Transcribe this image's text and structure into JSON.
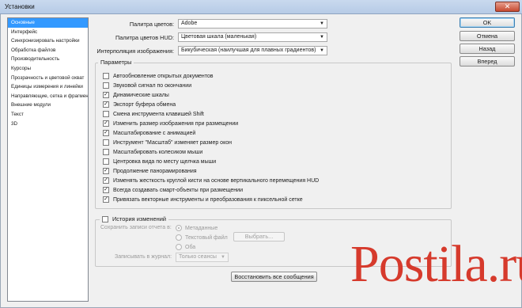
{
  "window": {
    "title": "Установки",
    "close_glyph": "✕"
  },
  "sidebar": {
    "items": [
      {
        "label": "Основные",
        "selected": true
      },
      {
        "label": "Интерфейс",
        "selected": false
      },
      {
        "label": "Синхронизировать настройки",
        "selected": false
      },
      {
        "label": "Обработка файлов",
        "selected": false
      },
      {
        "label": "Производительность",
        "selected": false
      },
      {
        "label": "Курсоры",
        "selected": false
      },
      {
        "label": "Прозрачность и цветовой охват",
        "selected": false
      },
      {
        "label": "Единицы измерения и линейки",
        "selected": false
      },
      {
        "label": "Направляющие, сетка и фрагменты",
        "selected": false
      },
      {
        "label": "Внешние модули",
        "selected": false
      },
      {
        "label": "Текст",
        "selected": false
      },
      {
        "label": "3D",
        "selected": false
      }
    ]
  },
  "general": {
    "color_picker_label": "Палитра цветов:",
    "color_picker_value": "Adobe",
    "hud_picker_label": "Палитра цветов HUD:",
    "hud_picker_value": "Цветовая шкала (маленькая)",
    "interpolation_label": "Интерполяция изображения:",
    "interpolation_value": "Бикубическая (наилучшая для плавных градиентов)",
    "dropdown_glyph": "▼"
  },
  "options": {
    "legend": "Параметры",
    "check_glyph": "✓",
    "items": [
      {
        "label": "Автообновление открытых документов",
        "checked": false
      },
      {
        "label": "Звуковой сигнал по окончании",
        "checked": false
      },
      {
        "label": "Динамические шкалы",
        "checked": true
      },
      {
        "label": "Экспорт буфера обмена",
        "checked": true
      },
      {
        "label": "Смена инструмента клавишей Shift",
        "checked": false
      },
      {
        "label": "Изменить размер изображения при размещении",
        "checked": true
      },
      {
        "label": "Масштабирование с анимацией",
        "checked": true
      },
      {
        "label": "Инструмент \"Масштаб\" изменяет размер окон",
        "checked": false
      },
      {
        "label": "Масштабировать колесиком мыши",
        "checked": false
      },
      {
        "label": "Центровка вида по месту щелчка мыши",
        "checked": false
      },
      {
        "label": "Продолжение панорамирования",
        "checked": true
      },
      {
        "label": "Изменять жесткость круглой кисти на основе вертикального перемещения HUD",
        "checked": true
      },
      {
        "label": "Всегда создавать смарт-объекты при размещении",
        "checked": true
      },
      {
        "label": "Привязать векторные инструменты и преобразования к пиксельной сетке",
        "checked": true
      }
    ]
  },
  "history": {
    "legend": "История изменений",
    "checked": false,
    "save_to_label": "Сохранить записи отчета в:",
    "radio_metadata": "Метаданные",
    "radio_textfile": "Текстовый файл",
    "radio_both": "Оба",
    "choose_button": "Выбрать...",
    "log_label": "Записывать в журнал:",
    "log_value": "Только сеансы"
  },
  "buttons": {
    "ok": "OK",
    "cancel": "Отмена",
    "back": "Назад",
    "forward": "Вперед",
    "reset_messages": "Восстановить все сообщения"
  },
  "watermark": {
    "text": "Postila.ru"
  }
}
